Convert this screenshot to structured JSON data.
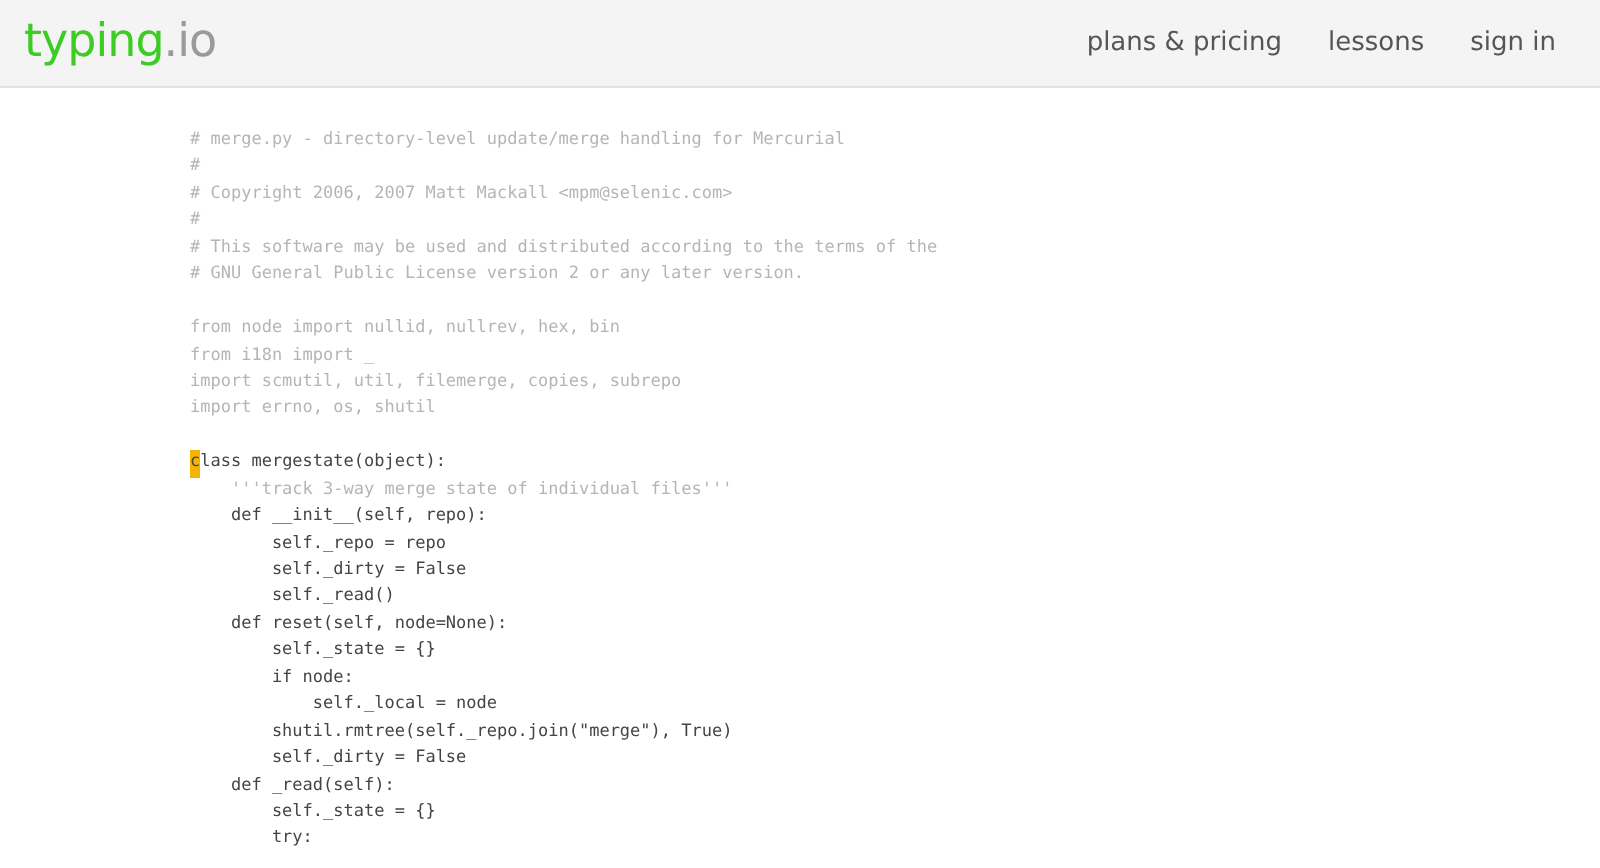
{
  "header": {
    "logo": {
      "name": "typing",
      "suffix": ".io"
    },
    "nav": [
      {
        "label": "plans & pricing"
      },
      {
        "label": "lessons"
      },
      {
        "label": "sign in"
      }
    ]
  },
  "code": {
    "lines": [
      {
        "kind": "dim",
        "text": "# merge.py - directory-level update/merge handling for Mercurial"
      },
      {
        "kind": "dim",
        "text": "#"
      },
      {
        "kind": "dim",
        "text": "# Copyright 2006, 2007 Matt Mackall <mpm@selenic.com>"
      },
      {
        "kind": "dim",
        "text": "#"
      },
      {
        "kind": "dim",
        "text": "# This software may be used and distributed according to the terms of the"
      },
      {
        "kind": "dim",
        "text": "# GNU General Public License version 2 or any later version."
      },
      {
        "kind": "blank"
      },
      {
        "kind": "dim",
        "text": "from node import nullid, nullrev, hex, bin"
      },
      {
        "kind": "dim",
        "text": "from i18n import _"
      },
      {
        "kind": "dim",
        "text": "import scmutil, util, filemerge, copies, subrepo"
      },
      {
        "kind": "dim",
        "text": "import errno, os, shutil"
      },
      {
        "kind": "blank"
      },
      {
        "kind": "code",
        "text": "class mergestate(object):",
        "cursor": true
      },
      {
        "kind": "dim",
        "text": "    '''track 3-way merge state of individual files'''"
      },
      {
        "kind": "code",
        "text": "    def __init__(self, repo):"
      },
      {
        "kind": "code",
        "text": "        self._repo = repo"
      },
      {
        "kind": "code",
        "text": "        self._dirty = False"
      },
      {
        "kind": "code",
        "text": "        self._read()"
      },
      {
        "kind": "code",
        "text": "    def reset(self, node=None):"
      },
      {
        "kind": "code",
        "text": "        self._state = {}"
      },
      {
        "kind": "code",
        "text": "        if node:"
      },
      {
        "kind": "code",
        "text": "            self._local = node"
      },
      {
        "kind": "code",
        "text": "        shutil.rmtree(self._repo.join(\"merge\"), True)"
      },
      {
        "kind": "code",
        "text": "        self._dirty = False"
      },
      {
        "kind": "code",
        "text": "    def _read(self):"
      },
      {
        "kind": "code",
        "text": "        self._state = {}"
      },
      {
        "kind": "code",
        "text": "        try:"
      }
    ]
  }
}
